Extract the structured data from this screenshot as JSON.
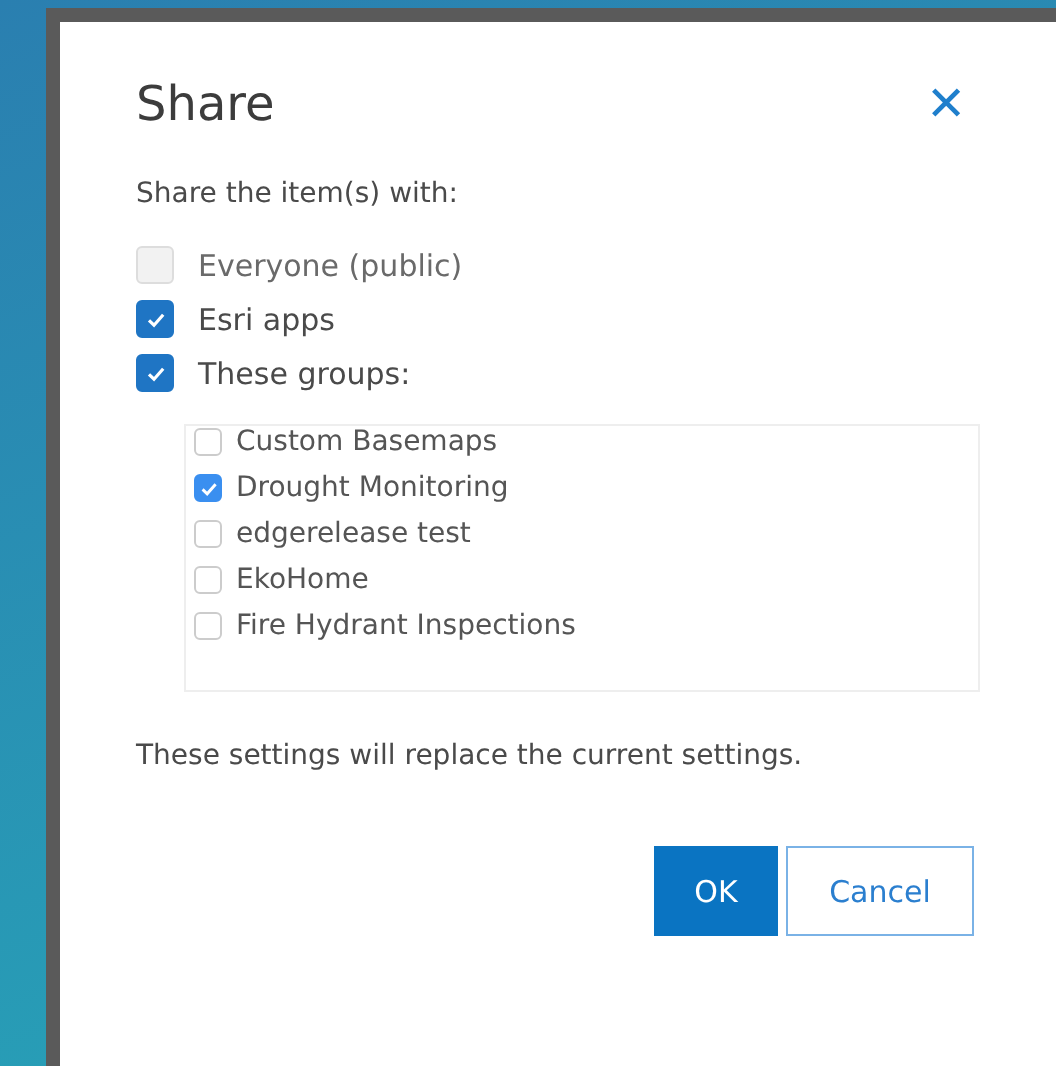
{
  "dialog": {
    "title": "Share",
    "close": "✕",
    "prompt": "Share the item(s) with:",
    "options": [
      {
        "label": "Everyone (public)",
        "checked": false,
        "disabled": true
      },
      {
        "label": "Esri apps",
        "checked": true,
        "disabled": false
      },
      {
        "label": "These groups:",
        "checked": true,
        "disabled": false
      }
    ],
    "groups": [
      {
        "label": "Custom Basemaps",
        "checked": false
      },
      {
        "label": "Drought Monitoring",
        "checked": true
      },
      {
        "label": "edgerelease test",
        "checked": false
      },
      {
        "label": "EkoHome",
        "checked": false
      },
      {
        "label": "Fire Hydrant Inspections",
        "checked": false
      }
    ],
    "note": "These settings will replace the current settings.",
    "buttons": [
      {
        "label": "OK",
        "kind": "primary"
      },
      {
        "label": "Cancel",
        "kind": "secondary"
      }
    ]
  }
}
